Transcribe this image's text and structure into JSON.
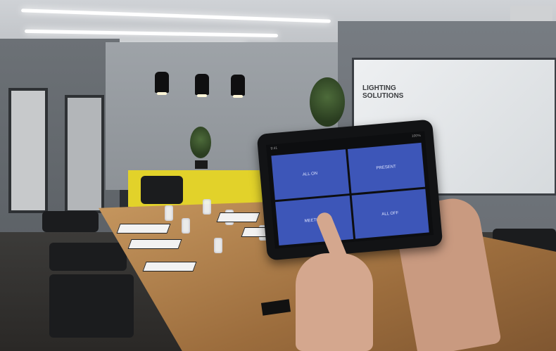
{
  "room": {
    "whiteboard_logo": {
      "line1": "LIGHTING",
      "line2": "SOLUTIONS"
    }
  },
  "tablet": {
    "status_left": "9:41",
    "status_right": "100%",
    "tiles": [
      {
        "label": "ALL ON"
      },
      {
        "label": "PRESENT"
      },
      {
        "label": "MEETING"
      },
      {
        "label": "ALL OFF"
      }
    ],
    "tile_color": "#3d56b8"
  },
  "colors": {
    "cabinet": "#e2d22a",
    "table_wood": "#b98a55"
  }
}
